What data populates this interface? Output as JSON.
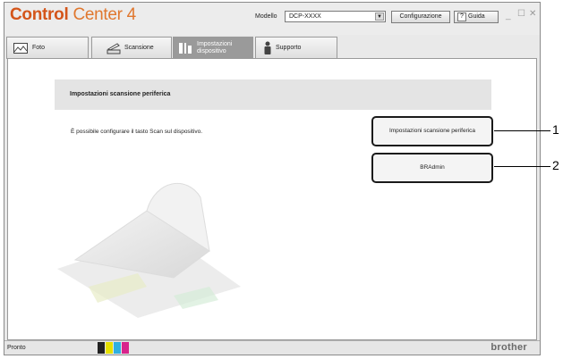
{
  "app": {
    "logo_part1": "Control",
    "logo_part2": "Center 4"
  },
  "header": {
    "model_label": "Modello",
    "model_value": "DCP-XXXX",
    "config_button": "Configurazione",
    "help_button": "Guida",
    "help_glyph": "?"
  },
  "tabs": [
    {
      "label": "Foto",
      "icon": "photo-icon"
    },
    {
      "label": "Scansione",
      "icon": "scanner-icon"
    },
    {
      "label_line1": "Impostazioni",
      "label_line2": "dispositivo",
      "icon": "device-settings-icon",
      "active": true
    },
    {
      "label": "Supporto",
      "icon": "support-person-icon"
    }
  ],
  "main": {
    "section_title": "Impostazioni scansione periferica",
    "description": "È possibile configurare il tasto Scan sul dispositivo.",
    "buttons": [
      {
        "label": "Impostazioni scansione periferica",
        "callout": "1"
      },
      {
        "label": "BRAdmin",
        "callout": "2"
      }
    ]
  },
  "status": {
    "text": "Pronto",
    "brand": "brother"
  },
  "colors": {
    "logo_orange": "#d4551a",
    "active_tab": "#9a9a9a"
  }
}
